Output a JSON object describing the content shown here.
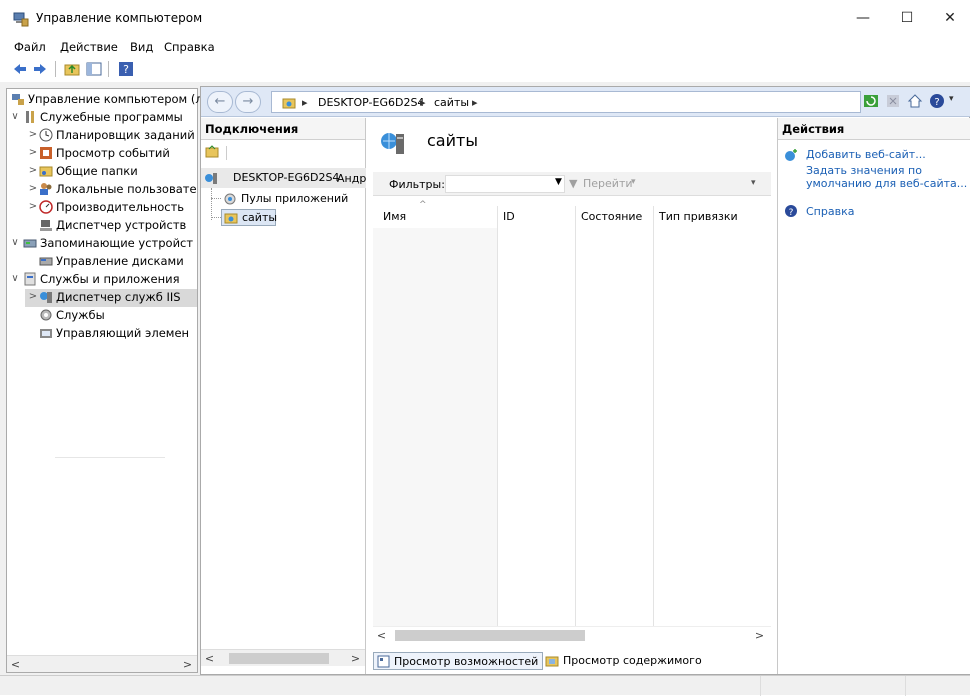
{
  "window": {
    "title": "Управление компьютером",
    "controls": [
      "—",
      "☐",
      "✕"
    ]
  },
  "menu": [
    "Файл",
    "Действие",
    "Вид",
    "Справка"
  ],
  "toolbar_icons": [
    "back-arrow-icon",
    "forward-arrow-icon",
    "up-folder-icon",
    "show-hide-tree-icon",
    "help-icon"
  ],
  "tree": {
    "items": [
      {
        "label": "Управление компьютером (л",
        "level": 0,
        "expander": "",
        "icon": "computer-management-icon"
      },
      {
        "label": "Служебные программы",
        "level": 0,
        "expander": "∨",
        "icon": "tools-icon"
      },
      {
        "label": "Планировщик заданий",
        "level": 1,
        "expander": ">",
        "icon": "clock-icon"
      },
      {
        "label": "Просмотр событий",
        "level": 1,
        "expander": ">",
        "icon": "event-viewer-icon"
      },
      {
        "label": "Общие папки",
        "level": 1,
        "expander": ">",
        "icon": "shared-folder-icon"
      },
      {
        "label": "Локальные пользовате",
        "level": 1,
        "expander": ">",
        "icon": "users-icon"
      },
      {
        "label": "Производительность",
        "level": 1,
        "expander": ">",
        "icon": "performance-icon"
      },
      {
        "label": "Диспетчер устройств",
        "level": 1,
        "expander": "",
        "icon": "device-manager-icon"
      },
      {
        "label": "Запоминающие устройст",
        "level": 0,
        "expander": "∨",
        "icon": "storage-icon"
      },
      {
        "label": "Управление дисками",
        "level": 1,
        "expander": "",
        "icon": "disk-icon"
      },
      {
        "label": "Службы и приложения",
        "level": 0,
        "expander": "∨",
        "icon": "services-apps-icon"
      },
      {
        "label": "Диспетчер служб IIS",
        "level": 1,
        "expander": ">",
        "icon": "iis-icon",
        "selected": true
      },
      {
        "label": "Службы",
        "level": 1,
        "expander": "",
        "icon": "services-icon"
      },
      {
        "label": "Управляющий элемен",
        "level": 1,
        "expander": "",
        "icon": "wmi-icon"
      }
    ]
  },
  "iis": {
    "breadcrumb": [
      "DESKTOP-EG6D2S4",
      "сайты"
    ],
    "connections": {
      "title": "Подключения",
      "server": "DESKTOP-EG6D2S4",
      "server_suffix": "Андр",
      "children": [
        "Пулы приложений",
        "сайты"
      ]
    },
    "center": {
      "title": "сайты",
      "filter_label": "Фильтры:",
      "go_label": "Перейти",
      "columns": [
        "Имя",
        "ID",
        "Состояние",
        "Тип привязки"
      ],
      "tabs": [
        "Просмотр возможностей",
        "Просмотр содержимого"
      ]
    },
    "actions": {
      "title": "Действия",
      "items": [
        "Добавить веб-сайт...",
        "Задать значения по умолчанию для веб-сайта...",
        "Справка"
      ],
      "item_lines": [
        "Задать значения по",
        "умолчанию для веб-сайта..."
      ]
    }
  },
  "colors": {
    "address_bar": "#dfe8f6",
    "link": "#1a5fb4",
    "selected": "#d9d9d9"
  }
}
